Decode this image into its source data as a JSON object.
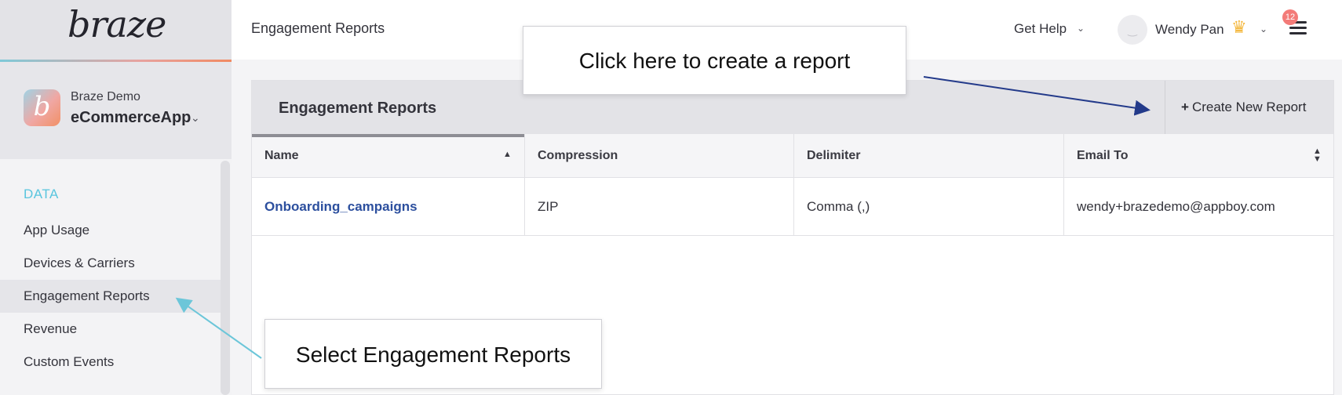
{
  "brand": {
    "logo_text": "braze"
  },
  "app": {
    "company": "Braze Demo",
    "name": "eCommerceApp"
  },
  "sidebar": {
    "section_label": "DATA",
    "items": [
      {
        "label": "App Usage"
      },
      {
        "label": "Devices & Carriers"
      },
      {
        "label": "Engagement Reports"
      },
      {
        "label": "Revenue"
      },
      {
        "label": "Custom Events"
      }
    ],
    "active_item": "Engagement Reports"
  },
  "topbar": {
    "page_title": "Engagement Reports",
    "help_label": "Get Help",
    "user_name": "Wendy Pan",
    "notification_count": "12"
  },
  "panel": {
    "title": "Engagement Reports",
    "create_button_label": "Create New Report",
    "columns": [
      "Name",
      "Compression",
      "Delimiter",
      "Email To"
    ],
    "rows": [
      {
        "name": "Onboarding_campaigns",
        "compression": "ZIP",
        "delimiter": "Comma (,)",
        "email_to": "wendy+brazedemo@appboy.com"
      }
    ]
  },
  "callouts": {
    "create": "Click here to create a report",
    "select": "Select Engagement Reports"
  },
  "colors": {
    "accent_teal": "#59c5de",
    "link_blue": "#2c4f9e",
    "arrow_navy": "#233a8a",
    "arrow_teal": "#6cc6d9",
    "badge_red": "#f37b78",
    "crown_gold": "#f4b73b"
  },
  "icons": [
    "chevron-down-icon",
    "crown-icon",
    "hamburger-menu-icon",
    "plus-icon",
    "sort-asc-icon",
    "sort-both-icon",
    "user-avatar-icon"
  ]
}
